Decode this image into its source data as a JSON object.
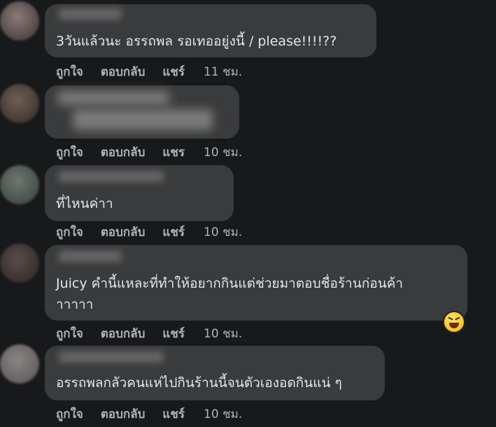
{
  "comments": [
    {
      "text": "3วันแล้วนะ อรรถพล รอเทออยู่งนี้ / please!!!!??",
      "actions": {
        "like": "ถูกใจ",
        "reply": "ตอบกลับ",
        "share": "แชร์",
        "time": "11 ชม."
      }
    },
    {
      "text": "",
      "actions": {
        "like": "ถูกใจ",
        "reply": "ตอบกลับ",
        "share": "แชร",
        "time": "10 ชม."
      }
    },
    {
      "text": "ที่ไหนค่าา",
      "actions": {
        "like": "ถูกใจ",
        "reply": "ตอบกลับ",
        "share": "แชร์",
        "time": "10 ชม."
      }
    },
    {
      "text_line1": "Juicy คำนี้แหละที่ทำให้อยากกินแต่ช่วยมาตอบชื่อร้านก่อนค้า",
      "text_line2": "าาาาา",
      "reaction_icon": "laughing-emoji-icon",
      "actions": {
        "like": "ถูกใจ",
        "reply": "ตอบกลับ",
        "share": "แชร์",
        "time": "10 ชม."
      }
    },
    {
      "text": "อรรถพลกลัวคนแห่ไปกินร้านนี้จนตัวเองอดกินแน่ ๆ",
      "actions": {
        "like": "ถูกใจ",
        "reply": "ตอบกลับ",
        "share": "แชร์",
        "time": "10 ชม."
      }
    }
  ]
}
